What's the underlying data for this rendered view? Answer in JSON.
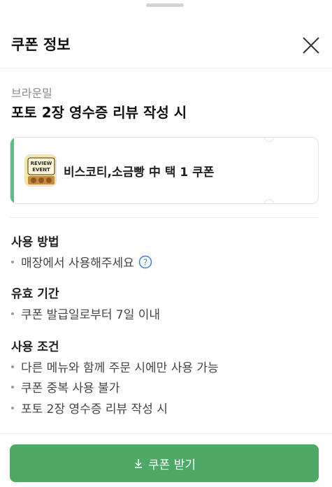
{
  "header": {
    "title": "쿠폰 정보"
  },
  "coupon": {
    "store_name": "브라운밀",
    "title": "포토 2장 영수증 리뷰 작성 시",
    "item_name": "비스코티,소금빵 中 택 1 쿠폰",
    "thumbnail_text": [
      "REVIEW",
      "EVENT"
    ]
  },
  "sections": {
    "usage_method": {
      "title": "사용 방법",
      "items": [
        "매장에서 사용해주세요"
      ]
    },
    "validity": {
      "title": "유효 기간",
      "items": [
        "쿠폰 발급일로부터 7일 이내"
      ]
    },
    "conditions": {
      "title": "사용 조건",
      "items": [
        "다른 메뉴와 함께 주문 시에만 사용 가능",
        "쿠폰 중복 사용 불가",
        "포토 2장 영수증 리뷰 작성 시"
      ]
    }
  },
  "footer": {
    "download_label": "쿠폰 받기"
  },
  "colors": {
    "accent": "#56c08a",
    "button": "#4caa66",
    "help_icon": "#3a7bd5"
  },
  "icons": {
    "close": "close-icon",
    "help": "question-circle-icon",
    "download": "download-arrow-icon"
  }
}
